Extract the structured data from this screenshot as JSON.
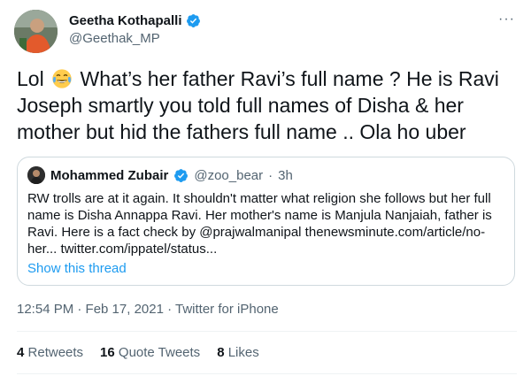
{
  "author": {
    "name": "Geetha Kothapalli",
    "handle": "@Geethak_MP"
  },
  "tweet_text": {
    "part1": "Lol ",
    "part2": " What’s her father Ravi’s full name ? He is Ravi Joseph smartly you told full names of Disha & her mother but  hid the fathers full name .. Ola ho uber"
  },
  "quoted": {
    "name": "Mohammed Zubair",
    "handle": "@zoo_bear",
    "separator": "·",
    "time": "3h",
    "text": "RW trolls are at it again. It shouldn't matter what religion she follows but her full name is Disha Annappa Ravi. Her mother's name is Manjula Nanjaiah, father is Ravi. Here is a fact check by @prajwalmanipal thenewsminute.com/article/no-her... twitter.com/ippatel/status...",
    "show_thread": "Show this thread"
  },
  "meta": "12:54 PM · Feb 17, 2021 · Twitter for iPhone",
  "stats": {
    "retweets_count": "4",
    "retweets_label": "Retweets",
    "quotes_count": "16",
    "quotes_label": "Quote Tweets",
    "likes_count": "8",
    "likes_label": "Likes"
  },
  "more_symbol": "···",
  "colors": {
    "accent": "#1d9bf0",
    "secondary_text": "#536471",
    "border": "#cfd9de"
  },
  "icons": [
    "verified-badge-icon",
    "tears-of-joy-emoji-icon",
    "more-options-icon"
  ]
}
